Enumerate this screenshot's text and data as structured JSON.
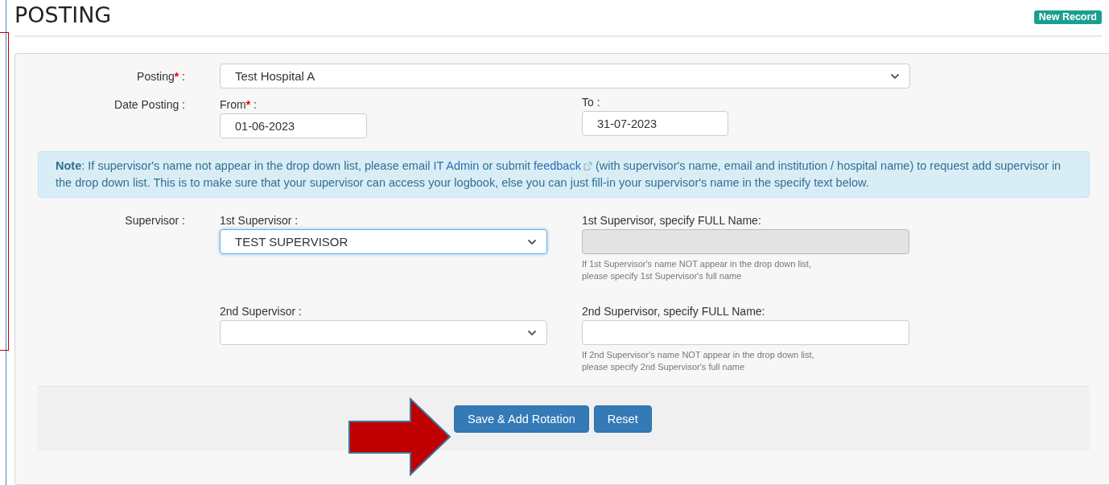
{
  "header": {
    "title": "POSTING",
    "badge": "New Record"
  },
  "posting": {
    "label": "Posting",
    "required_mark": "*",
    "separator": ":",
    "value": "Test Hospital A"
  },
  "date_posting": {
    "label": "Date Posting :",
    "from": {
      "label": "From",
      "required_mark": "*",
      "separator": ":",
      "value": "01-06-2023"
    },
    "to": {
      "label": "To",
      "separator": ":",
      "value": "31-07-2023"
    }
  },
  "note": {
    "parts": [
      {
        "kind": "bold",
        "text": "Note"
      },
      {
        "kind": "text",
        "text": ": If supervisor's name not appear in the drop down list, please email "
      },
      {
        "kind": "link",
        "text": "IT Admin",
        "external": false
      },
      {
        "kind": "text",
        "text": " or submit "
      },
      {
        "kind": "link",
        "text": "feedback",
        "external": true
      },
      {
        "kind": "text",
        "text": " (with supervisor's name, email and institution / hospital name) to request add supervisor in the drop down list. This is to make sure that your supervisor can access your logbook, else you can just fill-in your supervisor's name in the specify text below."
      }
    ]
  },
  "supervisor": {
    "label": "Supervisor :",
    "entries": [
      {
        "select_label": "1st Supervisor :",
        "value": "TEST SUPERVISOR",
        "focused": true,
        "name_label": "1st Supervisor, specify FULL Name:",
        "name_disabled": true,
        "help_lines": [
          "If 1st Supervisor's name NOT appear in the drop down list,",
          "please specify 1st Supervisor's full name"
        ]
      },
      {
        "select_label": "2nd Supervisor :",
        "focused": false,
        "name_label": "2nd Supervisor, specify FULL Name:",
        "name_disabled": false,
        "help_lines": [
          "If 2nd Supervisor's name NOT appear in the drop down list,",
          "please specify 2nd Supervisor's full name"
        ]
      }
    ]
  },
  "buttons": [
    {
      "label": "Save & Add Rotation"
    },
    {
      "label": "Reset"
    }
  ]
}
